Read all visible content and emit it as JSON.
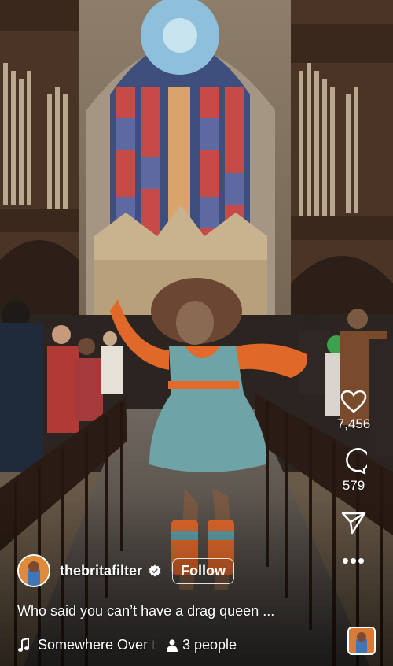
{
  "post": {
    "username": "thebritafilter",
    "follow_label": "Follow",
    "caption": "Who said you can’t have a drag queen ...",
    "audio": "Somewhere Over the Rainbow",
    "people": "3 people"
  },
  "actions": {
    "likes": "7,456",
    "comments": "579"
  },
  "icons": {
    "like": "heart-icon",
    "comment": "comment-icon",
    "share": "send-icon",
    "more": "more-icon",
    "verified": "verified-badge-icon",
    "music": "music-note-icon",
    "people": "person-icon"
  },
  "colors": {
    "text": "#ffffff",
    "dress": "#6ea3a8",
    "sleeves": "#e0692a"
  }
}
